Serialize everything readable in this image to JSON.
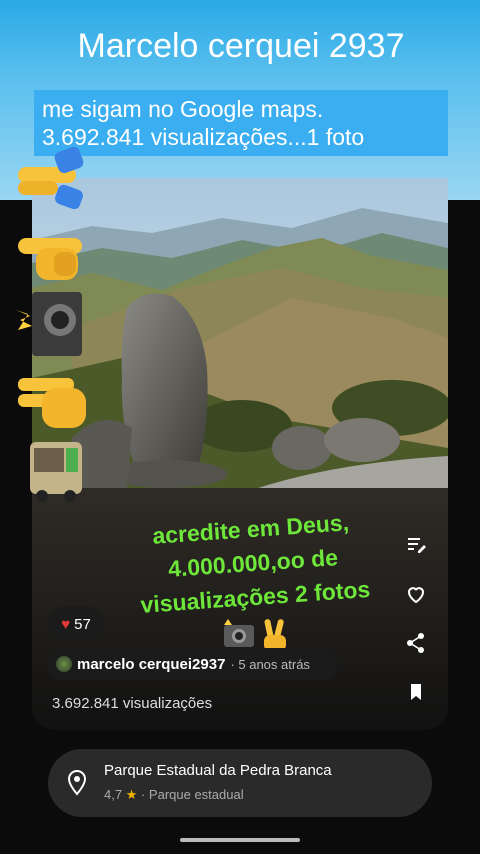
{
  "banner": {
    "title": "Marcelo cerquei 2937",
    "subtitle_line1": "me sigam no Google maps.",
    "subtitle_line2": "3.692.841 visualizações...1 foto"
  },
  "left_emojis": [
    "hands-point-right-icon",
    "backhand-point-right-icon",
    "camera-flash-icon",
    "victory-hand-icon",
    "bus-icon"
  ],
  "caption": {
    "line1": "acredite em Deus,",
    "line2": "4.000.000,oo de",
    "line3": "visualizações 2 fotos",
    "emojis": "📸✌"
  },
  "likes": {
    "count": "57"
  },
  "author": {
    "name": "marcelo cerquei2937",
    "time": " · 5 anos atrás"
  },
  "views": "3.692.841 visualizações",
  "actions": [
    "edit-review-icon",
    "heart-outline-icon",
    "share-icon",
    "bookmark-icon"
  ],
  "place": {
    "name": "Parque Estadual da Pedra Branca",
    "rating": "4,7",
    "star": "★",
    "category": " · Parque estadual"
  },
  "colors": {
    "banner_blue": "#3aaef0",
    "caption_green": "#6ee63a",
    "heart_red": "#e53935",
    "star": "#f5b400"
  }
}
